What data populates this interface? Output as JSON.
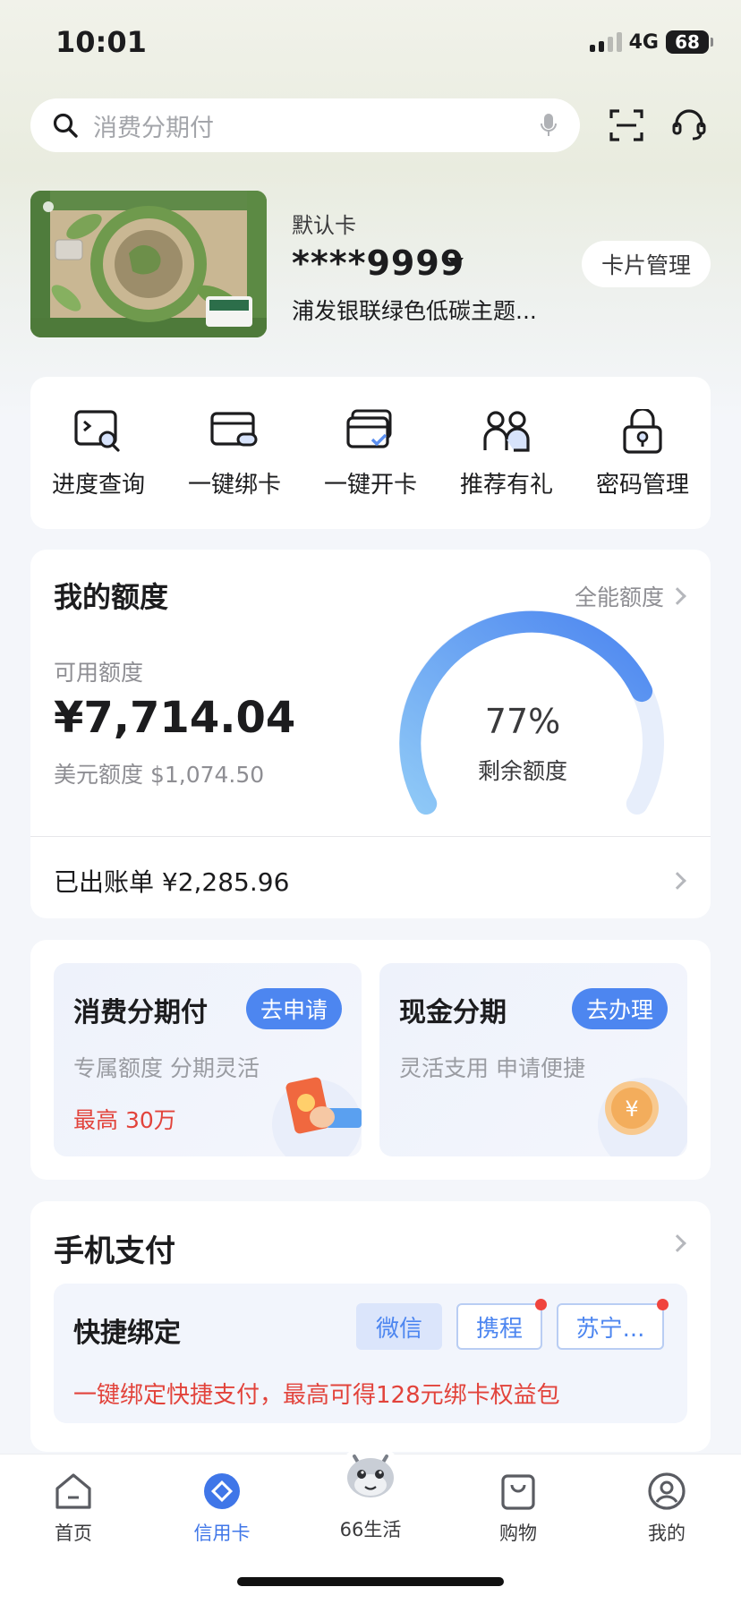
{
  "status_bar": {
    "time": "10:01",
    "network": "4G",
    "battery": "68"
  },
  "search": {
    "placeholder": "消费分期付"
  },
  "card": {
    "label": "默认卡",
    "number": "****9999",
    "name": "浦发银联绿色低碳主题...",
    "manage_label": "卡片管理"
  },
  "shortcuts": [
    {
      "label": "进度查询",
      "icon": "progress-search-icon"
    },
    {
      "label": "一键绑卡",
      "icon": "bind-card-icon"
    },
    {
      "label": "一键开卡",
      "icon": "open-card-icon"
    },
    {
      "label": "推荐有礼",
      "icon": "refer-friends-icon"
    },
    {
      "label": "密码管理",
      "icon": "password-lock-icon"
    }
  ],
  "credit": {
    "title": "我的额度",
    "more_label": "全能额度",
    "available_label": "可用额度",
    "available_amount": "¥7,714.04",
    "usd_label": "美元额度 $1,074.50",
    "remaining_pct": "77%",
    "remaining_fraction": 0.77,
    "remaining_label": "剩余额度",
    "bill_label": "已出账单 ¥2,285.96"
  },
  "installments": [
    {
      "title": "消费分期付",
      "button": "去申请",
      "subtitle": "专属额度 分期灵活",
      "highlight": "最高 30万"
    },
    {
      "title": "现金分期",
      "button": "去办理",
      "subtitle": "灵活支用 申请便捷"
    }
  ],
  "mobile_pay": {
    "title": "手机支付",
    "quick_title": "快捷绑定",
    "tags": [
      "微信",
      "携程",
      "苏宁..."
    ],
    "promo": "一键绑定快捷支付，最高可得128元绑卡权益包"
  },
  "bottom_nav": [
    {
      "label": "首页",
      "icon": "home-icon"
    },
    {
      "label": "信用卡",
      "icon": "credit-card-tab-icon"
    },
    {
      "label": "66生活",
      "icon": "dragon-mascot-icon"
    },
    {
      "label": "购物",
      "icon": "shopping-bag-icon"
    },
    {
      "label": "我的",
      "icon": "profile-icon"
    }
  ],
  "colors": {
    "accent": "#4d86f0",
    "alert": "#e2433b",
    "gauge": "#5b9ef0"
  }
}
